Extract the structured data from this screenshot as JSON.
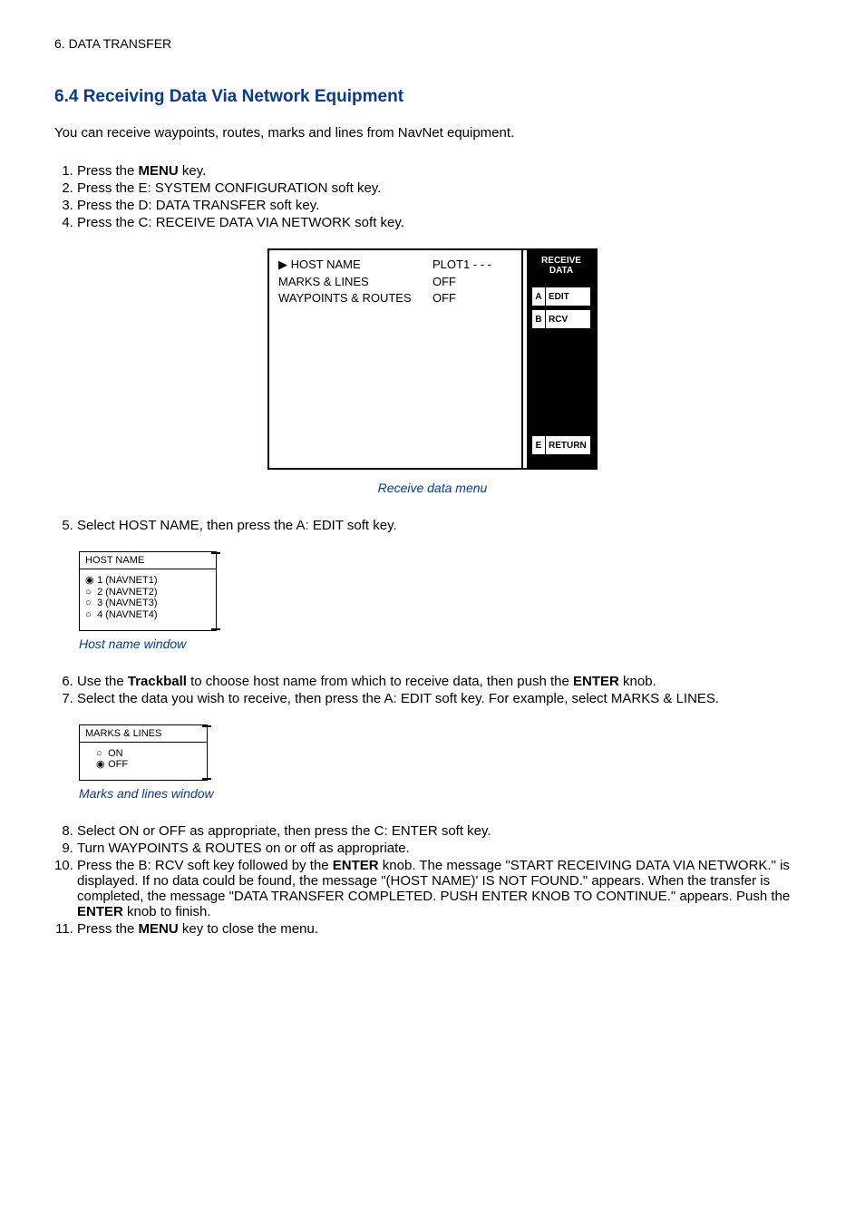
{
  "header": "6.  DATA  TRANSFER",
  "section_title": "6.4 Receiving Data Via Network Equipment",
  "intro": "You can receive waypoints, routes, marks and lines from NavNet equipment.",
  "steps_a": [
    {
      "pre": "Press the ",
      "bold": "MENU",
      "post": " key."
    },
    {
      "pre": "Press the E: SYSTEM CONFIGURATION soft key.",
      "bold": "",
      "post": ""
    },
    {
      "pre": "Press the D: DATA TRANSFER soft key.",
      "bold": "",
      "post": ""
    },
    {
      "pre": "Press the C: RECEIVE DATA VIA NETWORK soft key.",
      "bold": "",
      "post": ""
    }
  ],
  "screen": {
    "rows": [
      {
        "label": "▶ HOST NAME",
        "value": "PLOT1 - - -"
      },
      {
        "label": "   MARKS & LINES",
        "value": "OFF"
      },
      {
        "label": "   WAYPOINTS & ROUTES",
        "value": "OFF"
      }
    ],
    "panel_title1": "RECEIVE",
    "panel_title2": "DATA",
    "keys": [
      {
        "letter": "A",
        "label": "EDIT"
      },
      {
        "letter": "B",
        "label": "RCV"
      }
    ],
    "return_key": {
      "letter": "E",
      "label": "RETURN"
    }
  },
  "caption1": "Receive data menu",
  "step5": "Select HOST NAME, then press the A: EDIT soft key.",
  "hostname_box": {
    "title": "HOST NAME",
    "items": [
      {
        "sel": true,
        "text": "1 (NAVNET1)"
      },
      {
        "sel": false,
        "text": "2 (NAVNET2)"
      },
      {
        "sel": false,
        "text": "3 (NAVNET3)"
      },
      {
        "sel": false,
        "text": "4 (NAVNET4)"
      }
    ]
  },
  "caption2": "Host name window",
  "step6_pre": "Use the ",
  "step6_bold1": "Trackball",
  "step6_mid": " to choose host name from which to receive data, then push the ",
  "step6_bold2": "ENTER",
  "step6_post": " knob.",
  "step7": "Select the data you wish to receive, then press the A: EDIT soft key. For example, select MARKS & LINES.",
  "marks_box": {
    "title": "MARKS & LINES",
    "items": [
      {
        "sel": false,
        "text": "ON"
      },
      {
        "sel": true,
        "text": "OFF"
      }
    ]
  },
  "caption3": "Marks and lines window",
  "step8": "Select ON or OFF as appropriate, then press the C: ENTER soft key.",
  "step9": "Turn WAYPOINTS & ROUTES on or off as appropriate.",
  "step10_pre": "Press the B: RCV soft key followed by the ",
  "step10_bold1": "ENTER",
  "step10_mid": " knob. The message \"START RECEIVING DATA VIA NETWORK.\" is displayed. If no data could be found, the message \"(HOST NAME)' IS NOT FOUND.\" appears. When the transfer is completed, the message \"DATA TRANSFER COMPLETED. PUSH ENTER KNOB TO CONTINUE.\" appears. Push the ",
  "step10_bold2": "ENTER",
  "step10_post": " knob to finish.",
  "step11_pre": "Press the ",
  "step11_bold": "MENU",
  "step11_post": " key to close the menu."
}
